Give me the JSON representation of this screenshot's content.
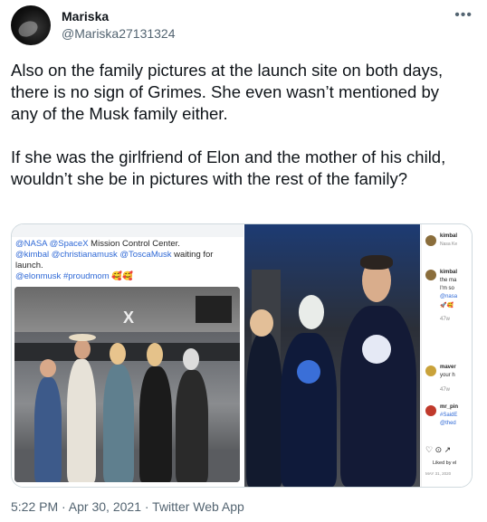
{
  "author": {
    "display_name": "Mariska",
    "handle": "@Mariska27131324"
  },
  "more_icon": "more-horizontal-icon",
  "tweet": {
    "paragraphs": [
      "Also on the family pictures at the launch site on both days, there is no sign of Grimes. She even wasn’t mentioned by any of the Musk family either.",
      "If she was the girlfriend of Elon and the mother of his child, wouldn’t she be in pictures with the rest of the family?"
    ],
    "timestamp": "5:22 PM · Apr 30, 2021 · Twitter Web App"
  },
  "left_image": {
    "caption_line1_tags": "@NASA @SpaceX",
    "caption_line1_text": " Mission Control Center.",
    "caption_line2_tags": "@kimbal @christianamusk @ToscaMusk",
    "caption_line2_text": " waiting for launch.",
    "caption_line3_tags": "@elonmusk #proudmom",
    "caption_line3_emoji": "🥰🥰",
    "logo_text": "X"
  },
  "instagram_sidebar": {
    "comment1_user": "kimbal",
    "comment1_sub": "Nasa Ke",
    "comment2_user": "kimbal",
    "comment2_lines": [
      "the ma",
      "I'm so",
      "@nasa"
    ],
    "comment2_emoji": "🚀🥰",
    "comment2_time": "47w",
    "comment3_user": "maver",
    "comment3_text": "your h",
    "comment3_time": "47w",
    "comment4_user": "mr_pin",
    "comment4_tag": "#SaidE",
    "comment4_mention": "@thed",
    "actions": "♡ ⊙ ↗",
    "liked_by": "Liked by el",
    "date": "MAY 31, 2020"
  }
}
